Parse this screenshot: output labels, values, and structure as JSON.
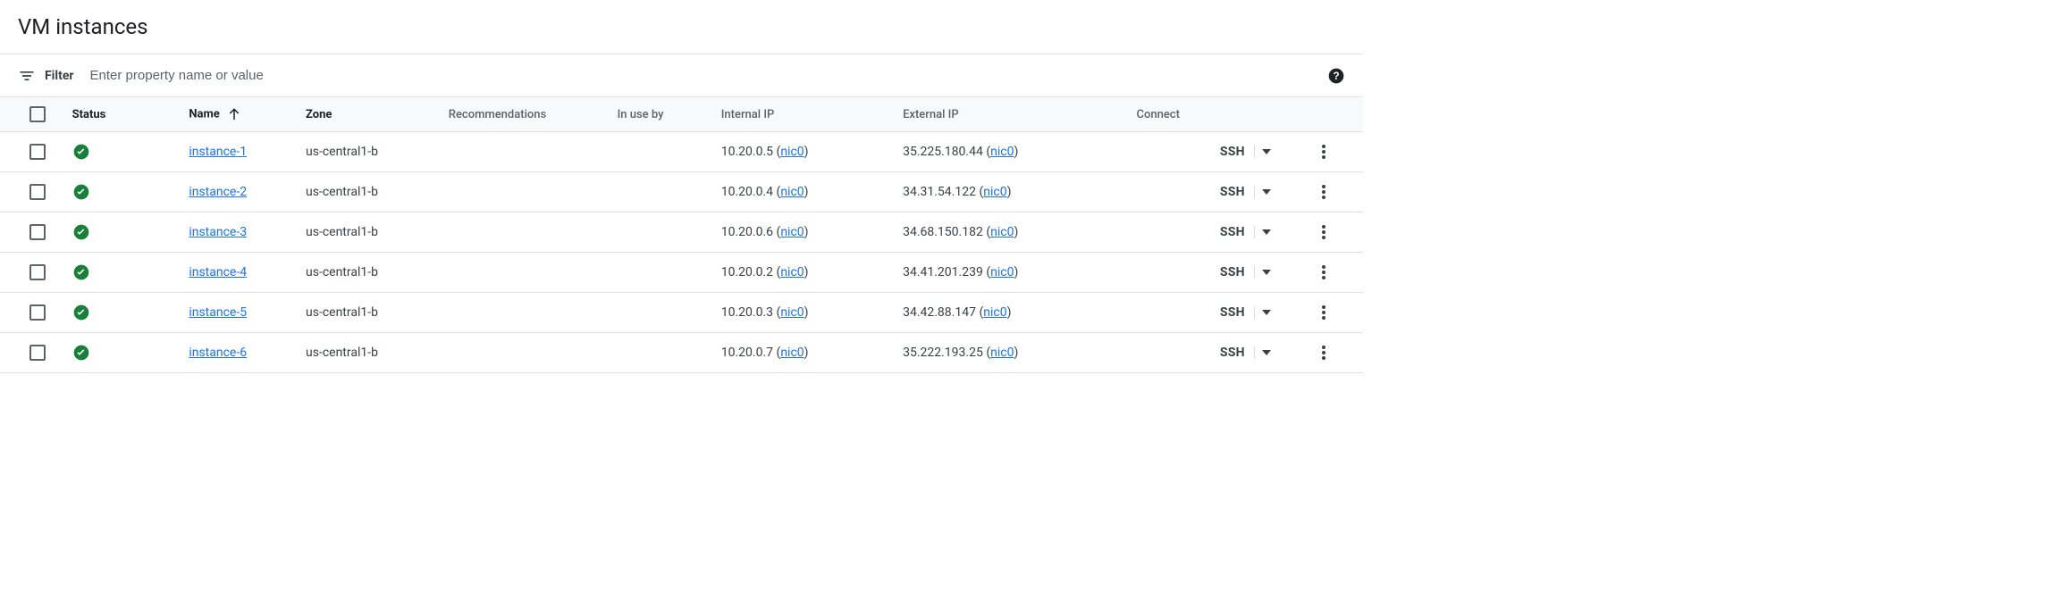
{
  "page_title": "VM instances",
  "filter": {
    "label": "Filter",
    "placeholder": "Enter property name or value"
  },
  "columns": {
    "status": "Status",
    "name": "Name",
    "zone": "Zone",
    "recommendations": "Recommendations",
    "in_use_by": "In use by",
    "internal_ip": "Internal IP",
    "external_ip": "External IP",
    "connect": "Connect"
  },
  "ssh_label": "SSH",
  "nic_label": "nic0",
  "rows": [
    {
      "name": "instance-1",
      "zone": "us-central1-b",
      "internal_ip": "10.20.0.5",
      "external_ip": "35.225.180.44"
    },
    {
      "name": "instance-2",
      "zone": "us-central1-b",
      "internal_ip": "10.20.0.4",
      "external_ip": "34.31.54.122"
    },
    {
      "name": "instance-3",
      "zone": "us-central1-b",
      "internal_ip": "10.20.0.6",
      "external_ip": "34.68.150.182"
    },
    {
      "name": "instance-4",
      "zone": "us-central1-b",
      "internal_ip": "10.20.0.2",
      "external_ip": "34.41.201.239"
    },
    {
      "name": "instance-5",
      "zone": "us-central1-b",
      "internal_ip": "10.20.0.3",
      "external_ip": "34.42.88.147"
    },
    {
      "name": "instance-6",
      "zone": "us-central1-b",
      "internal_ip": "10.20.0.7",
      "external_ip": "35.222.193.25"
    }
  ]
}
